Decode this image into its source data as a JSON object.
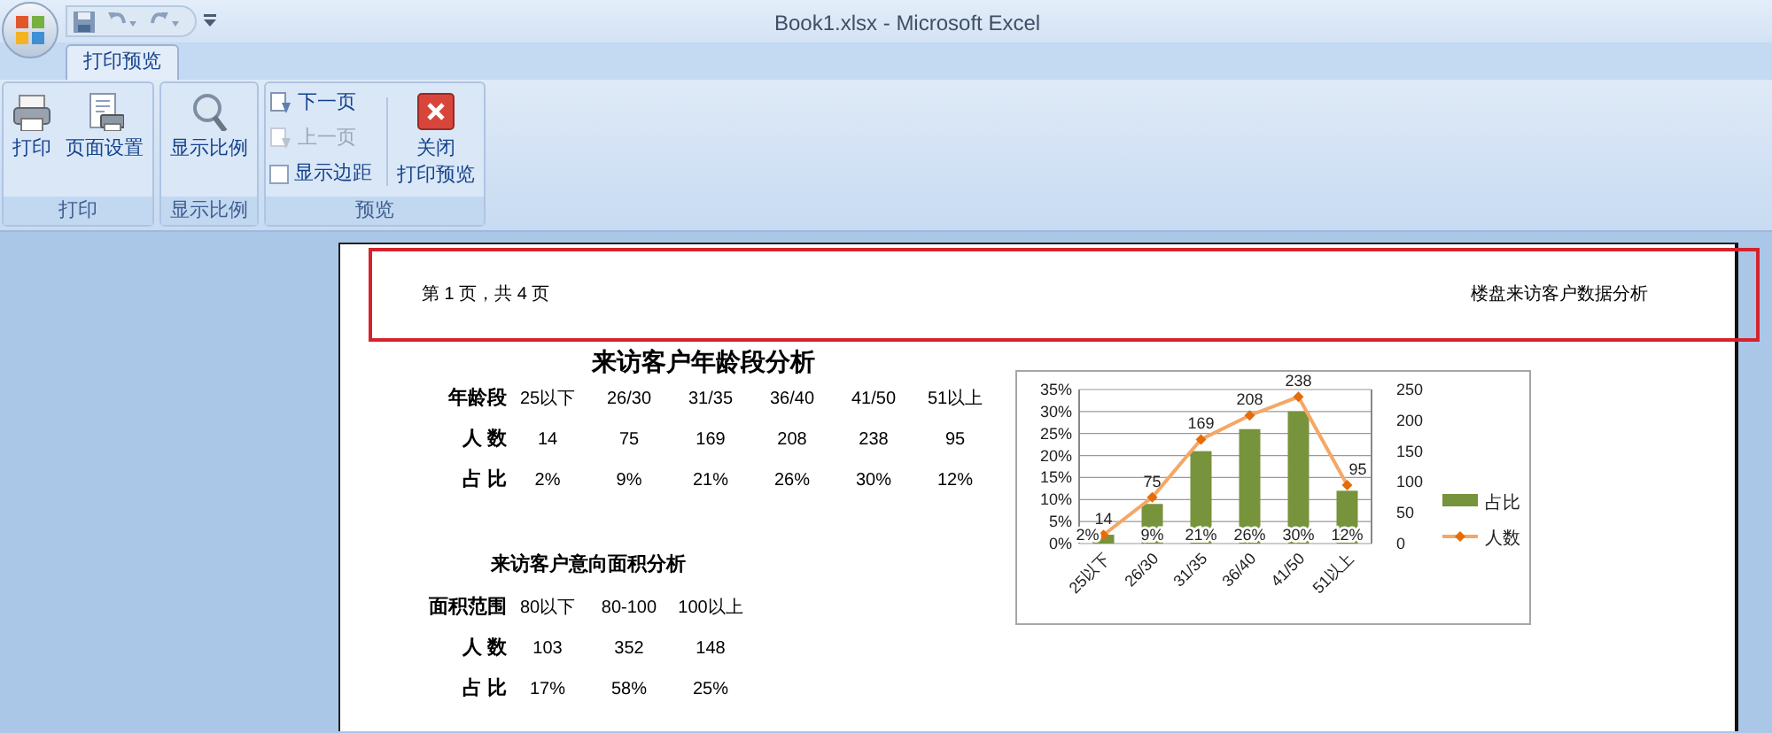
{
  "window": {
    "title": "Book1.xlsx - Microsoft Excel"
  },
  "tabs": [
    {
      "label": "打印预览",
      "selected": true
    }
  ],
  "ribbon": {
    "groups": [
      {
        "label": "打印",
        "buttons": [
          {
            "kind": "large",
            "label": "打印"
          },
          {
            "kind": "large",
            "label": "页面设置"
          }
        ]
      },
      {
        "label": "显示比例",
        "buttons": [
          {
            "kind": "large",
            "label": "显示比例"
          }
        ]
      },
      {
        "label": "预览",
        "buttons": [
          {
            "kind": "small",
            "label": "下一页",
            "disabled": false
          },
          {
            "kind": "small",
            "label": "上一页",
            "disabled": true
          },
          {
            "kind": "check",
            "label": "显示边距",
            "checked": false
          },
          {
            "kind": "large",
            "label_lines": [
              "关闭",
              "打印预览"
            ]
          }
        ]
      }
    ]
  },
  "page": {
    "header": {
      "left": "第 1 页，共 4 页",
      "right": "楼盘来访客户数据分析",
      "highlighted": true
    },
    "age_table": {
      "title": "来访客户年龄段分析",
      "rows": [
        {
          "label": "年龄段",
          "cells": [
            "25以下",
            "26/30",
            "31/35",
            "36/40",
            "41/50",
            "51以上"
          ]
        },
        {
          "label": "人 数",
          "cells": [
            "14",
            "75",
            "169",
            "208",
            "238",
            "95"
          ]
        },
        {
          "label": "占 比",
          "cells": [
            "2%",
            "9%",
            "21%",
            "26%",
            "30%",
            "12%"
          ]
        }
      ]
    },
    "chart_data": {
      "type": "bar",
      "categories": [
        "25以下",
        "26/30",
        "31/35",
        "36/40",
        "41/50",
        "51以上"
      ],
      "series": [
        {
          "name": "占比",
          "color": "#77933c",
          "type": "bar",
          "values": [
            0.02,
            0.09,
            0.21,
            0.26,
            0.3,
            0.12
          ],
          "value_labels": [
            "2%",
            "9%",
            "21%",
            "26%",
            "30%",
            "12%"
          ]
        },
        {
          "name": "人数",
          "color": "#f5a766",
          "type": "line",
          "axis": "y2",
          "marker": "diamond",
          "values": [
            14,
            75,
            169,
            208,
            238,
            95
          ],
          "value_labels": [
            "14",
            "75",
            "169",
            "208",
            "238",
            "95"
          ]
        }
      ],
      "ylim": [
        0,
        0.35
      ],
      "yticks": [
        {
          "value": 0,
          "label": "0%"
        },
        {
          "value": 0.05,
          "label": "5%"
        },
        {
          "value": 0.1,
          "label": "10%"
        },
        {
          "value": 0.15,
          "label": "15%"
        },
        {
          "value": 0.2,
          "label": "20%"
        },
        {
          "value": 0.25,
          "label": "25%"
        },
        {
          "value": 0.3,
          "label": "30%"
        },
        {
          "value": 0.35,
          "label": "35%"
        }
      ],
      "grid": true,
      "legend": "right",
      "y2lim": [
        0,
        250
      ],
      "y2ticks": [
        0,
        50,
        100,
        150,
        200,
        250
      ],
      "data_labels": true
    },
    "area_table": {
      "title": "来访客户意向面积分析",
      "rows": [
        {
          "label": "面积范围",
          "cells": [
            "80以下",
            "80-100",
            "100以上"
          ]
        },
        {
          "label": "人 数",
          "cells": [
            "103",
            "352",
            "148"
          ]
        },
        {
          "label": "占 比",
          "cells": [
            "17%",
            "58%",
            "25%"
          ]
        }
      ]
    }
  }
}
